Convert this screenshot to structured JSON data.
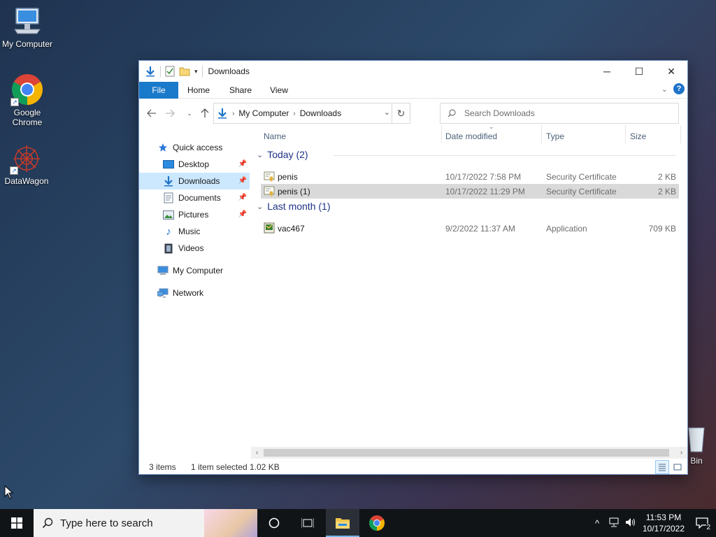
{
  "desktop": {
    "icons": [
      {
        "label": "My Computer",
        "icon": "computer-icon"
      },
      {
        "label": "Google Chrome",
        "icon": "chrome-icon"
      },
      {
        "label": "DataWagon",
        "icon": "datawagon-icon"
      },
      {
        "label": "Bin",
        "icon": "recycle-bin-icon"
      }
    ]
  },
  "window": {
    "title": "Downloads",
    "controls": {
      "minimize": "─",
      "maximize": "☐",
      "close": "✕"
    },
    "ribbon_tabs": [
      "File",
      "Home",
      "Share",
      "View"
    ],
    "help": "?",
    "address": {
      "crumbs": [
        "My Computer",
        "Downloads"
      ],
      "refresh": "↻"
    },
    "search": {
      "placeholder": "Search Downloads",
      "value": ""
    },
    "nav_pane": [
      {
        "label": "Quick access",
        "icon": "star-icon",
        "pinned": false
      },
      {
        "label": "Desktop",
        "icon": "desktop-folder-icon",
        "pinned": true
      },
      {
        "label": "Downloads",
        "icon": "download-folder-icon",
        "pinned": true,
        "selected": true
      },
      {
        "label": "Documents",
        "icon": "documents-folder-icon",
        "pinned": true
      },
      {
        "label": "Pictures",
        "icon": "pictures-folder-icon",
        "pinned": true
      },
      {
        "label": "Music",
        "icon": "music-folder-icon",
        "pinned": false
      },
      {
        "label": "Videos",
        "icon": "videos-folder-icon",
        "pinned": false
      },
      {
        "label": "My Computer",
        "icon": "computer-icon",
        "pinned": false
      },
      {
        "label": "Network",
        "icon": "network-icon",
        "pinned": false
      }
    ],
    "columns": [
      "Name",
      "Date modified",
      "Type",
      "Size"
    ],
    "groups": [
      {
        "label": "Today (2)",
        "files": [
          {
            "name": "penis",
            "date": "10/17/2022 7:58 PM",
            "type": "Security Certificate",
            "size": "2 KB",
            "icon": "certificate-icon",
            "selected": false
          },
          {
            "name": "penis (1)",
            "date": "10/17/2022 11:29 PM",
            "type": "Security Certificate",
            "size": "2 KB",
            "icon": "certificate-icon",
            "selected": true
          }
        ]
      },
      {
        "label": "Last month (1)",
        "files": [
          {
            "name": "vac467",
            "date": "9/2/2022 11:37 AM",
            "type": "Application",
            "size": "709 KB",
            "icon": "application-icon",
            "selected": false
          }
        ]
      }
    ],
    "status": {
      "count": "3 items",
      "selection": "1 item selected",
      "size": "1.02 KB"
    }
  },
  "taskbar": {
    "search_placeholder": "Type here to search",
    "clock": {
      "time": "11:53 PM",
      "date": "10/17/2022"
    },
    "notifications": "2"
  },
  "colors": {
    "accent": "#1979ca",
    "selection": "#cce8ff",
    "group_header": "#1e3287"
  }
}
